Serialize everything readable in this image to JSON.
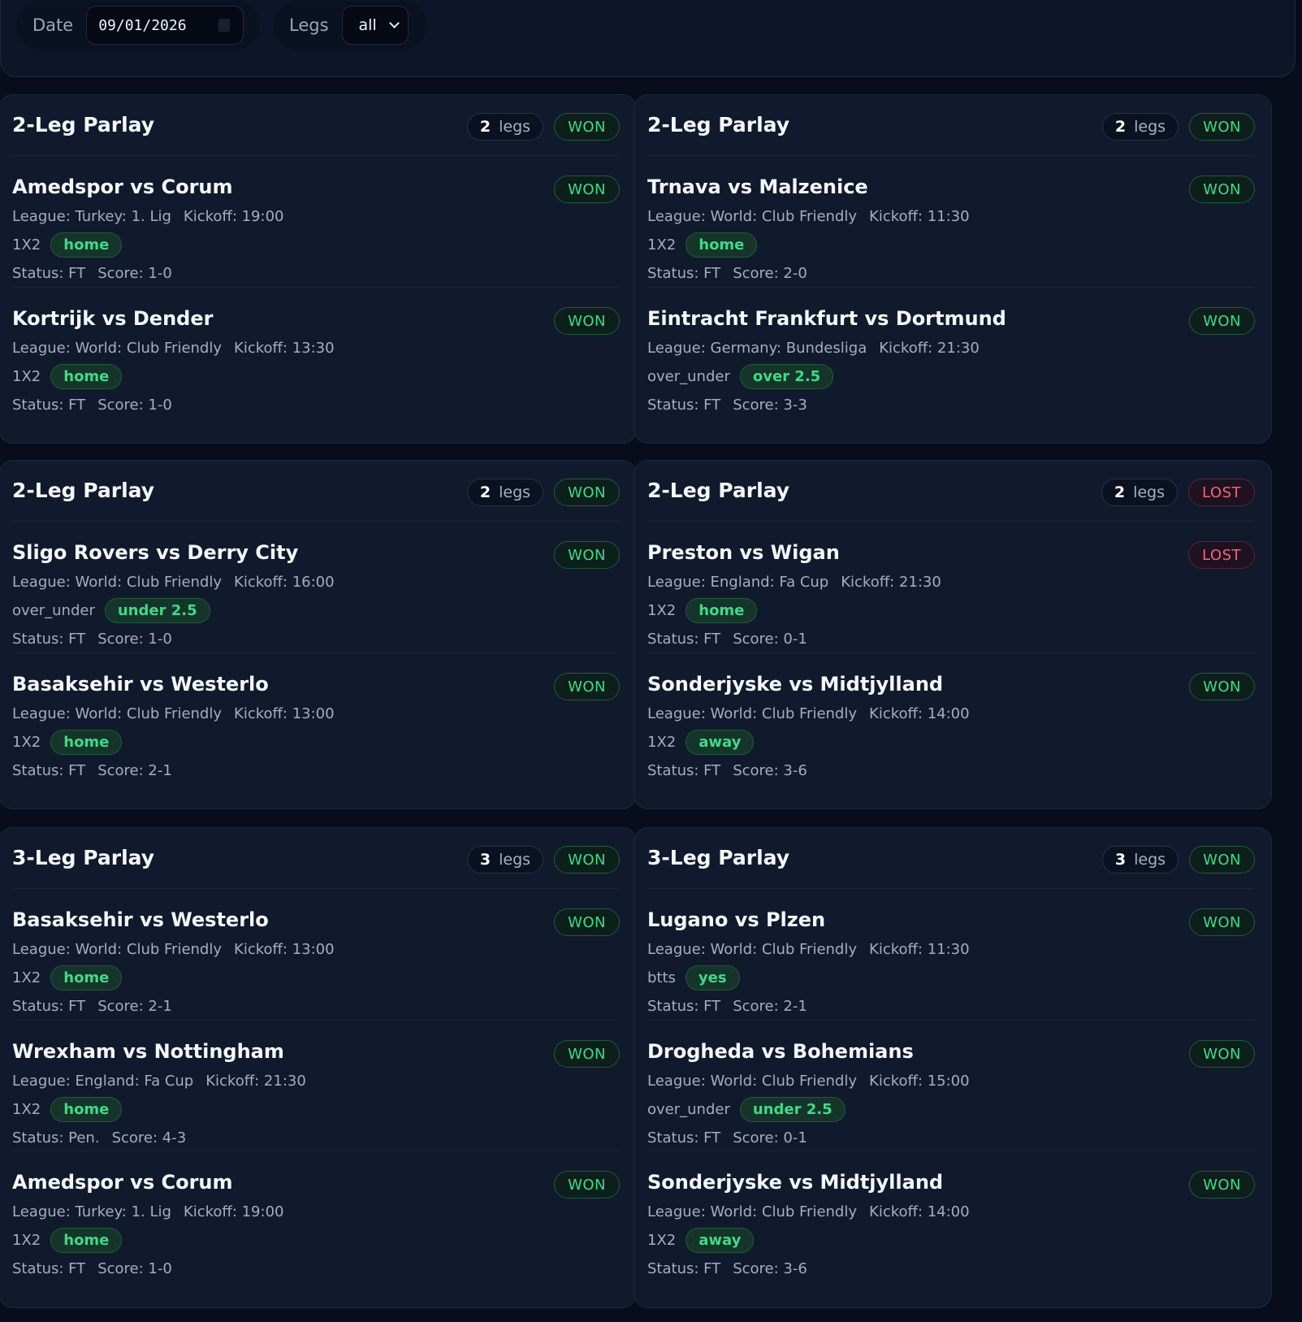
{
  "filters": {
    "date_label": "Date",
    "date_value": "09/01/2026",
    "legs_label": "Legs",
    "legs_value": "all"
  },
  "legs_suffix": "legs",
  "parlays": [
    {
      "title": "2-Leg Parlay",
      "legs_count": "2",
      "status": "WON",
      "legs": [
        {
          "match": "Amedspor vs Corum",
          "status": "WON",
          "league": "League: Turkey: 1. Lig",
          "kickoff": "Kickoff: 19:00",
          "market": "1X2",
          "pick": "home",
          "match_status": "Status: FT",
          "score": "Score: 1-0"
        },
        {
          "match": "Kortrijk vs Dender",
          "status": "WON",
          "league": "League: World: Club Friendly",
          "kickoff": "Kickoff: 13:30",
          "market": "1X2",
          "pick": "home",
          "match_status": "Status: FT",
          "score": "Score: 1-0"
        }
      ]
    },
    {
      "title": "2-Leg Parlay",
      "legs_count": "2",
      "status": "WON",
      "legs": [
        {
          "match": "Trnava vs Malzenice",
          "status": "WON",
          "league": "League: World: Club Friendly",
          "kickoff": "Kickoff: 11:30",
          "market": "1X2",
          "pick": "home",
          "match_status": "Status: FT",
          "score": "Score: 2-0"
        },
        {
          "match": "Eintracht Frankfurt vs Dortmund",
          "status": "WON",
          "league": "League: Germany: Bundesliga",
          "kickoff": "Kickoff: 21:30",
          "market": "over_under",
          "pick": "over 2.5",
          "match_status": "Status: FT",
          "score": "Score: 3-3"
        }
      ]
    },
    {
      "title": "2-Leg Parlay",
      "legs_count": "2",
      "status": "WON",
      "legs": [
        {
          "match": "Sligo Rovers vs Derry City",
          "status": "WON",
          "league": "League: World: Club Friendly",
          "kickoff": "Kickoff: 16:00",
          "market": "over_under",
          "pick": "under 2.5",
          "match_status": "Status: FT",
          "score": "Score: 1-0"
        },
        {
          "match": "Basaksehir vs Westerlo",
          "status": "WON",
          "league": "League: World: Club Friendly",
          "kickoff": "Kickoff: 13:00",
          "market": "1X2",
          "pick": "home",
          "match_status": "Status: FT",
          "score": "Score: 2-1"
        }
      ]
    },
    {
      "title": "2-Leg Parlay",
      "legs_count": "2",
      "status": "LOST",
      "legs": [
        {
          "match": "Preston vs Wigan",
          "status": "LOST",
          "league": "League: England: Fa Cup",
          "kickoff": "Kickoff: 21:30",
          "market": "1X2",
          "pick": "home",
          "match_status": "Status: FT",
          "score": "Score: 0-1"
        },
        {
          "match": "Sonderjyske vs Midtjylland",
          "status": "WON",
          "league": "League: World: Club Friendly",
          "kickoff": "Kickoff: 14:00",
          "market": "1X2",
          "pick": "away",
          "match_status": "Status: FT",
          "score": "Score: 3-6"
        }
      ]
    },
    {
      "title": "3-Leg Parlay",
      "legs_count": "3",
      "status": "WON",
      "legs": [
        {
          "match": "Basaksehir vs Westerlo",
          "status": "WON",
          "league": "League: World: Club Friendly",
          "kickoff": "Kickoff: 13:00",
          "market": "1X2",
          "pick": "home",
          "match_status": "Status: FT",
          "score": "Score: 2-1"
        },
        {
          "match": "Wrexham vs Nottingham",
          "status": "WON",
          "league": "League: England: Fa Cup",
          "kickoff": "Kickoff: 21:30",
          "market": "1X2",
          "pick": "home",
          "match_status": "Status: Pen.",
          "score": "Score: 4-3"
        },
        {
          "match": "Amedspor vs Corum",
          "status": "WON",
          "league": "League: Turkey: 1. Lig",
          "kickoff": "Kickoff: 19:00",
          "market": "1X2",
          "pick": "home",
          "match_status": "Status: FT",
          "score": "Score: 1-0"
        }
      ]
    },
    {
      "title": "3-Leg Parlay",
      "legs_count": "3",
      "status": "WON",
      "legs": [
        {
          "match": "Lugano vs Plzen",
          "status": "WON",
          "league": "League: World: Club Friendly",
          "kickoff": "Kickoff: 11:30",
          "market": "btts",
          "pick": "yes",
          "match_status": "Status: FT",
          "score": "Score: 2-1"
        },
        {
          "match": "Drogheda vs Bohemians",
          "status": "WON",
          "league": "League: World: Club Friendly",
          "kickoff": "Kickoff: 15:00",
          "market": "over_under",
          "pick": "under 2.5",
          "match_status": "Status: FT",
          "score": "Score: 0-1"
        },
        {
          "match": "Sonderjyske vs Midtjylland",
          "status": "WON",
          "league": "League: World: Club Friendly",
          "kickoff": "Kickoff: 14:00",
          "market": "1X2",
          "pick": "away",
          "match_status": "Status: FT",
          "score": "Score: 3-6"
        }
      ]
    }
  ]
}
